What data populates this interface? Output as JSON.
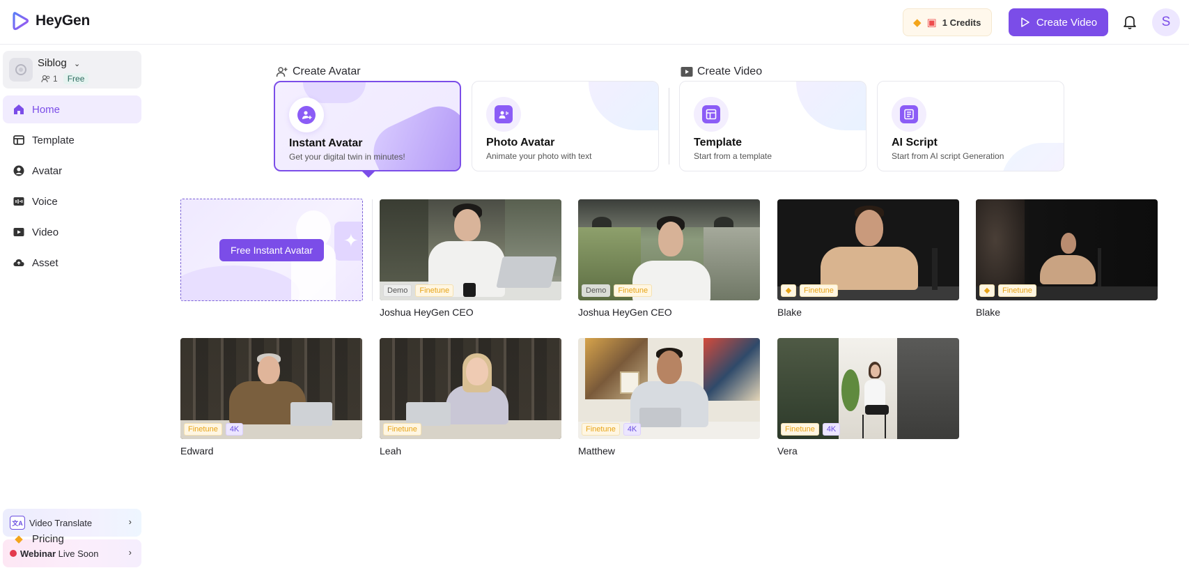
{
  "app": {
    "name": "HeyGen"
  },
  "header": {
    "credits_label": "1 Credits",
    "create_video_label": "Create Video",
    "user_initial": "S"
  },
  "workspace": {
    "name": "Siblog",
    "members": "1",
    "plan": "Free"
  },
  "sidebar": {
    "items": [
      {
        "label": "Home",
        "icon": "home-icon"
      },
      {
        "label": "Template",
        "icon": "template-icon"
      },
      {
        "label": "Avatar",
        "icon": "avatar-icon"
      },
      {
        "label": "Voice",
        "icon": "voice-icon"
      },
      {
        "label": "Video",
        "icon": "video-icon"
      },
      {
        "label": "Asset",
        "icon": "cloud-icon"
      }
    ],
    "video_translate_label": "Video Translate",
    "webinar_bold": "Webinar",
    "webinar_rest": " Live Soon",
    "pricing_label": "Pricing"
  },
  "main": {
    "create_avatar_label": "Create Avatar",
    "create_video_label": "Create Video",
    "cards": [
      {
        "title": "Instant Avatar",
        "subtitle": "Get your digital twin in minutes!"
      },
      {
        "title": "Photo Avatar",
        "subtitle": "Animate your photo with text"
      },
      {
        "title": "Template",
        "subtitle": "Start from a template"
      },
      {
        "title": "AI Script",
        "subtitle": "Start from AI script Generation"
      }
    ],
    "free_instant_label": "Free Instant Avatar",
    "tag_labels": {
      "demo": "Demo",
      "finetune": "Finetune",
      "k4": "4K"
    },
    "avatars": [
      {
        "name": "Joshua HeyGen CEO"
      },
      {
        "name": "Joshua HeyGen CEO"
      },
      {
        "name": "Blake"
      },
      {
        "name": "Blake"
      },
      {
        "name": "Edward"
      },
      {
        "name": "Leah"
      },
      {
        "name": "Matthew"
      },
      {
        "name": "Vera"
      }
    ]
  },
  "colors": {
    "accent": "#7b4de8",
    "finetune": "#e7a417",
    "live": "#e33a4e"
  }
}
